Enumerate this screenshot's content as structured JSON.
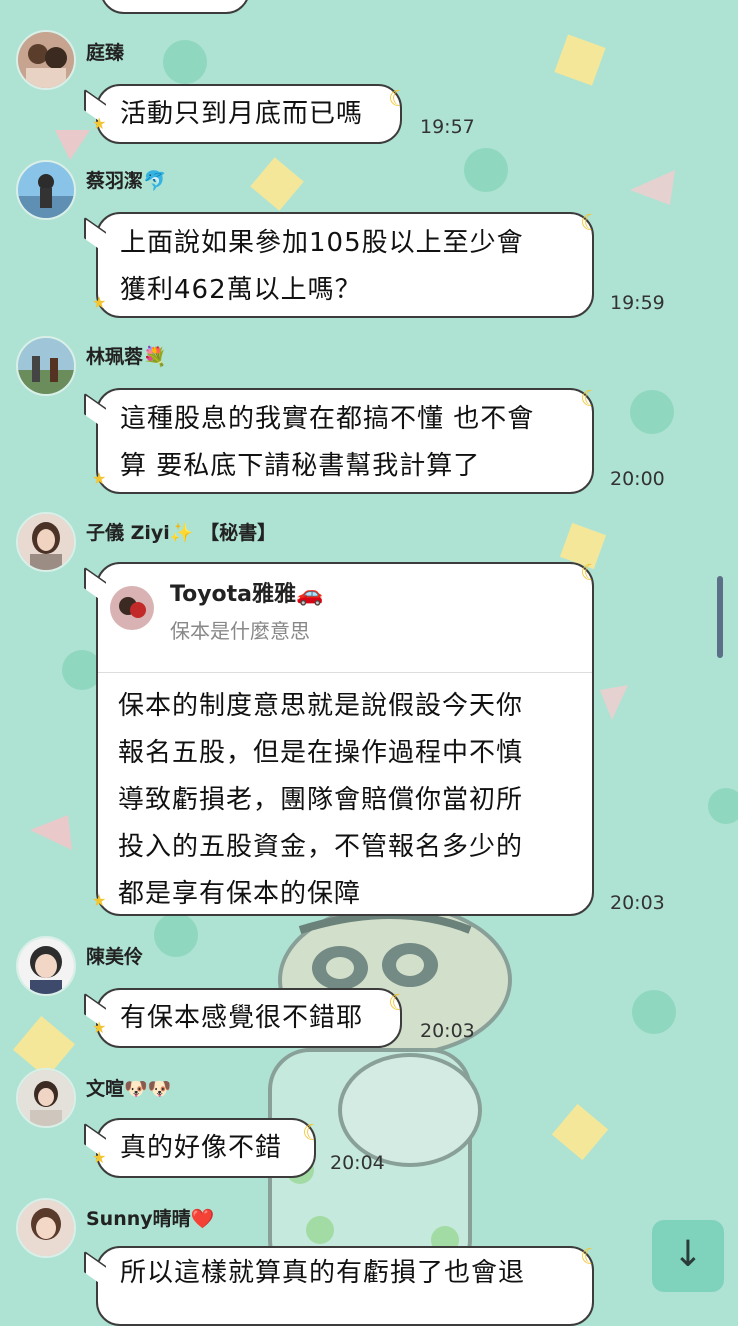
{
  "messages": [
    {
      "name": "庭臻",
      "text": "活動只到月底而已嗎",
      "time": "19:57",
      "avatar": "user-avatar"
    },
    {
      "name": "蔡羽潔🐬",
      "text": "上面說如果參加105股以上至少會\n獲利462萬以上嗎？",
      "time": "19:59",
      "avatar": "user-avatar"
    },
    {
      "name": "林珮蓉💐",
      "text": "這種股息的我實在都搞不懂 也不會\n算 要私底下請秘書幫我計算了",
      "time": "20:00",
      "avatar": "user-avatar"
    },
    {
      "name": "子儀 Ziyi✨ 【秘書】",
      "text": "保本的制度意思就是說假設今天你\n報名五股，但是在操作過程中不慎\n導致虧損老，團隊會賠償你當初所\n投入的五股資金，不管報名多少的\n都是享有保本的保障",
      "time": "20:03",
      "avatar": "user-avatar",
      "reply": {
        "name": "Toyota雅雅🚗",
        "quote": "保本是什麼意思"
      }
    },
    {
      "name": "陳美伶",
      "text": "有保本感覺很不錯耶",
      "time": "20:03",
      "avatar": "user-avatar"
    },
    {
      "name": "文暄🐶🐶",
      "text": "真的好像不錯",
      "time": "20:04",
      "avatar": "user-avatar"
    },
    {
      "name": "Sunny晴晴❤️",
      "text": "所以這樣就算真的有虧損了也會退",
      "time": "",
      "avatar": "user-avatar"
    }
  ],
  "icons": {
    "scroll_down": "arrow-down-icon",
    "moon": "moon-icon",
    "star": "star-icon"
  },
  "colors": {
    "background": "#aee3d3",
    "bubble": "#ffffff",
    "border": "#3c3c3c",
    "accent": "#f3c531"
  }
}
